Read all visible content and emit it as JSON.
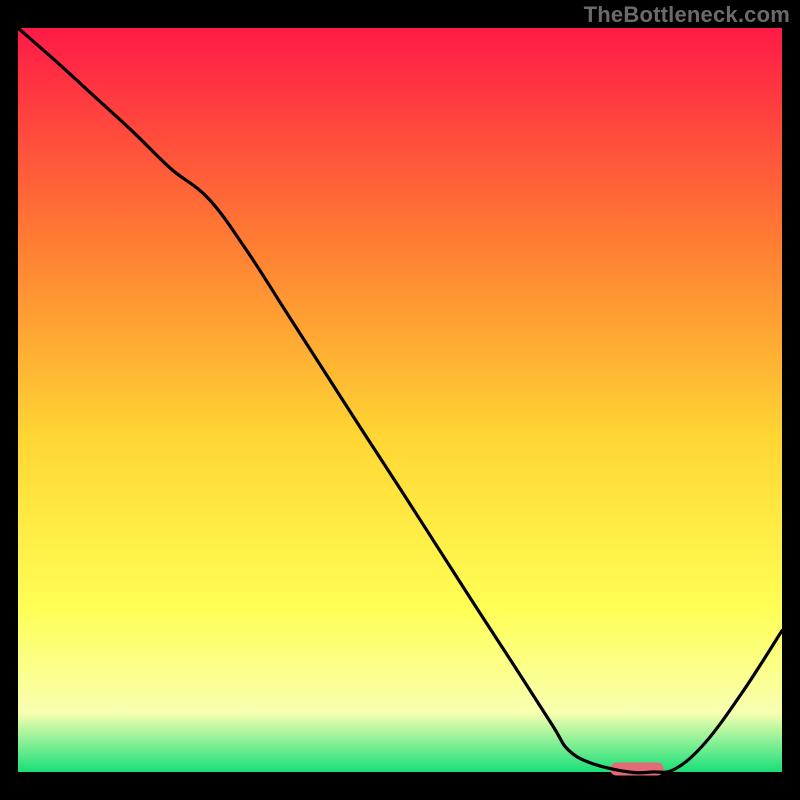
{
  "watermark": "TheBottleneck.com",
  "colors": {
    "black": "#000000",
    "marker": "#e46a75",
    "grad_top": "#ff1a47",
    "grad_mid_upper": "#ff7a33",
    "grad_mid": "#ffd633",
    "grad_mid_lower": "#ffff55",
    "grad_pale": "#f8ffb0",
    "grad_bottom": "#18e07a"
  },
  "chart_data": {
    "type": "line",
    "title": "",
    "xlabel": "",
    "ylabel": "",
    "xlim": [
      0,
      100
    ],
    "ylim": [
      0,
      100
    ],
    "x": [
      0,
      5,
      10,
      15,
      20,
      25,
      30,
      35,
      40,
      45,
      50,
      55,
      60,
      65,
      70,
      72,
      75,
      80,
      83,
      86,
      90,
      95,
      100
    ],
    "values": [
      100,
      95.5,
      90.8,
      86.1,
      81.1,
      77.0,
      70.0,
      62.0,
      54.0,
      46.0,
      38.1,
      30.1,
      22.1,
      14.2,
      6.2,
      3.0,
      1.2,
      0.0,
      0.0,
      0.4,
      4.0,
      11.0,
      19.0
    ],
    "marker": {
      "x_start": 77.5,
      "x_end": 84.5,
      "y": 0.0
    },
    "annotations": []
  }
}
